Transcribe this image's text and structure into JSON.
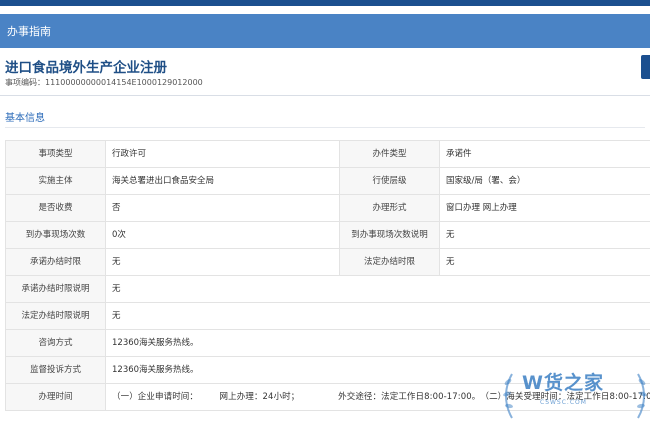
{
  "header": {
    "title": "办事指南"
  },
  "page": {
    "title": "进口食品境外生产企业注册",
    "code_label": "事项编码：",
    "code": "11100000000014154E1000129012000"
  },
  "section": {
    "title": "基本信息"
  },
  "rows": [
    {
      "k1": "事项类型",
      "v1": "行政许可",
      "k2": "办件类型",
      "v2": "承诺件"
    },
    {
      "k1": "实施主体",
      "v1": "海关总署进出口食品安全局",
      "k2": "行使层级",
      "v2": "国家级/局（署、会）"
    },
    {
      "k1": "是否收费",
      "v1": "否",
      "k2": "办理形式",
      "v2": "窗口办理 网上办理"
    },
    {
      "k1": "到办事现场次数",
      "v1": "0次",
      "k2": "到办事现场次数说明",
      "v2": "无"
    },
    {
      "k1": "承诺办结时限",
      "v1": "无",
      "k2": "法定办结时限",
      "v2": "无"
    }
  ],
  "wide_rows": [
    {
      "k": "承诺办结时限说明",
      "v": "无"
    },
    {
      "k": "法定办结时限说明",
      "v": "无"
    },
    {
      "k": "咨询方式",
      "v": "12360海关服务热线。"
    },
    {
      "k": "监督投诉方式",
      "v": "12360海关服务热线。"
    },
    {
      "k": "办理时间",
      "v": "（一）企业申请时间：　　　网上办理：24小时；　　　　　外交途径：法定工作日8:00-17:00。　（二）海关受理时间：法定工作日8:00-17:00"
    }
  ],
  "watermark": {
    "text": "W货之家",
    "sub": "CSWSC.COM"
  },
  "colors": {
    "header_bg": "#4a83c5",
    "title": "#1f4f86",
    "section": "#2a6ab8"
  }
}
